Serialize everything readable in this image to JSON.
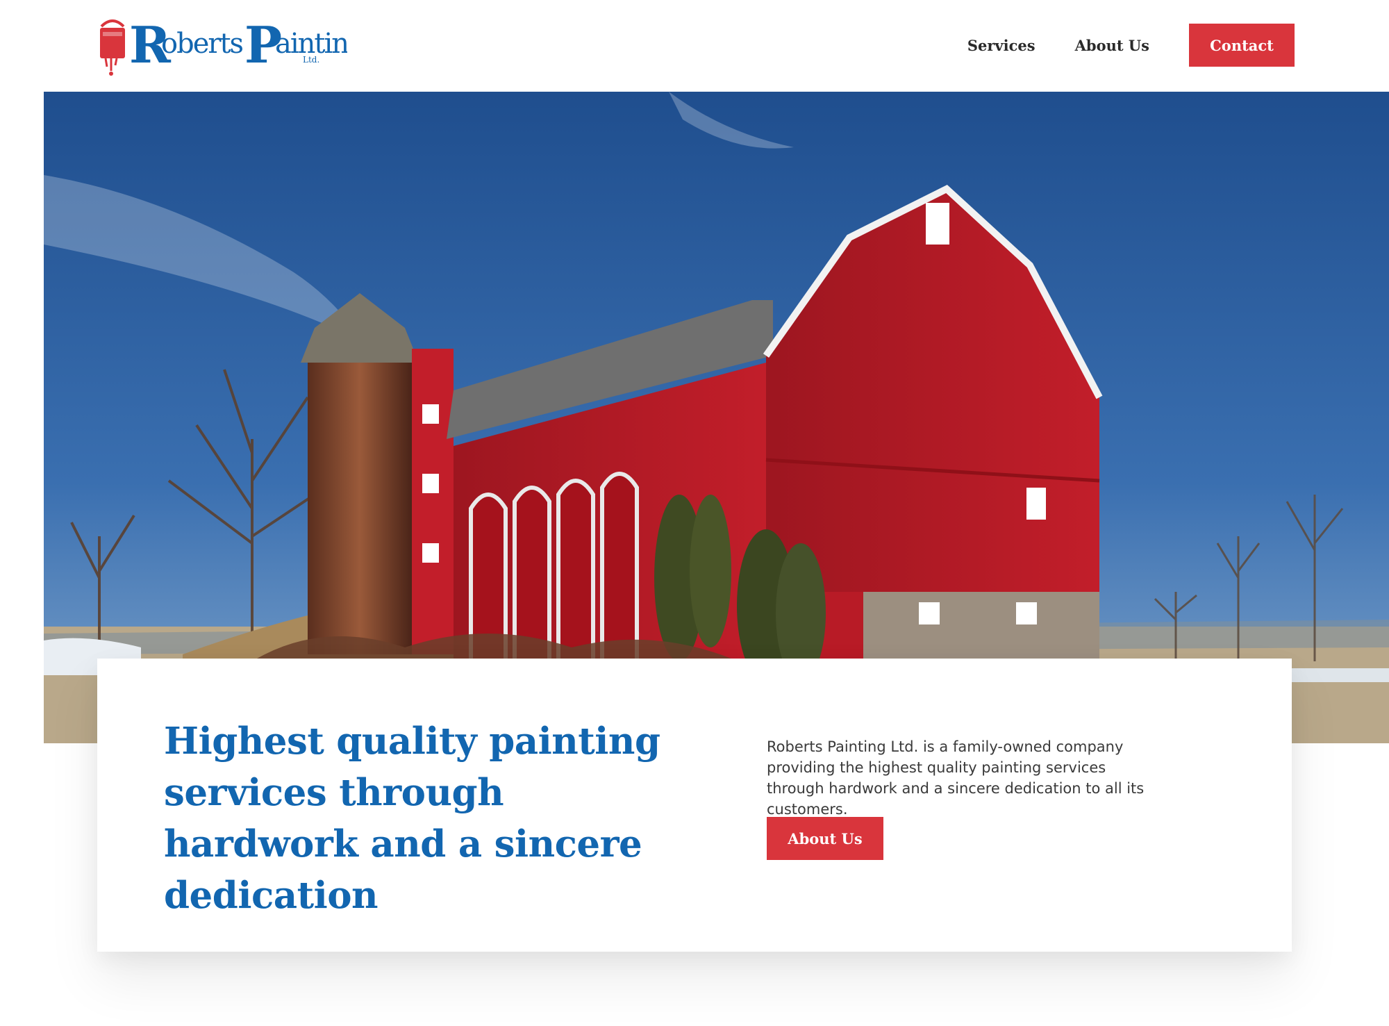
{
  "header": {
    "logo": {
      "text_r": "R",
      "text_oberts": "oberts",
      "text_p": "P",
      "text_ainting": "ainting",
      "text_ltd": "Ltd."
    },
    "nav": [
      {
        "label": "Services"
      },
      {
        "label": "About Us"
      }
    ],
    "contact_label": "Contact"
  },
  "hero": {
    "image": "red-barn-with-silo-photo"
  },
  "card": {
    "headline": "Highest quality painting services through hardwork and a sincere dedication",
    "description": "Roberts Painting Ltd. is a family-owned company providing the highest quality painting services through hardwork and a sincere dedication to all its customers.",
    "cta_label": "About Us"
  },
  "colors": {
    "brand_blue": "#1266b0",
    "brand_red": "#d9353c",
    "text_dark": "#2a2a2a"
  }
}
